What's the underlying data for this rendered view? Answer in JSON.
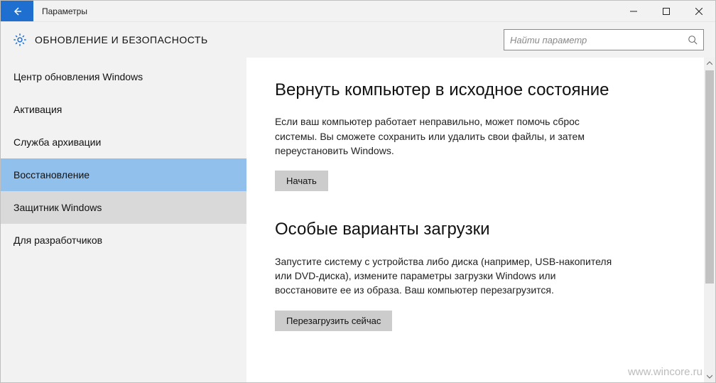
{
  "window": {
    "title": "Параметры"
  },
  "header": {
    "title": "ОБНОВЛЕНИЕ И БЕЗОПАСНОСТЬ",
    "search_placeholder": "Найти параметр"
  },
  "sidebar": {
    "items": [
      {
        "label": "Центр обновления Windows",
        "state": "normal"
      },
      {
        "label": "Активация",
        "state": "normal"
      },
      {
        "label": "Служба архивации",
        "state": "normal"
      },
      {
        "label": "Восстановление",
        "state": "selected"
      },
      {
        "label": "Защитник Windows",
        "state": "hover"
      },
      {
        "label": "Для разработчиков",
        "state": "normal"
      }
    ]
  },
  "content": {
    "sections": [
      {
        "heading": "Вернуть компьютер в исходное состояние",
        "body": "Если ваш компьютер работает неправильно, может помочь сброс системы. Вы сможете сохранить или удалить свои файлы, и затем переустановить Windows.",
        "button": "Начать"
      },
      {
        "heading": "Особые варианты загрузки",
        "body": "Запустите систему с устройства либо диска (например, USB-накопителя или DVD-диска), измените параметры загрузки Windows или восстановите ее из образа. Ваш компьютер перезагрузится.",
        "button": "Перезагрузить сейчас"
      }
    ]
  },
  "watermark": "www.wincore.ru"
}
